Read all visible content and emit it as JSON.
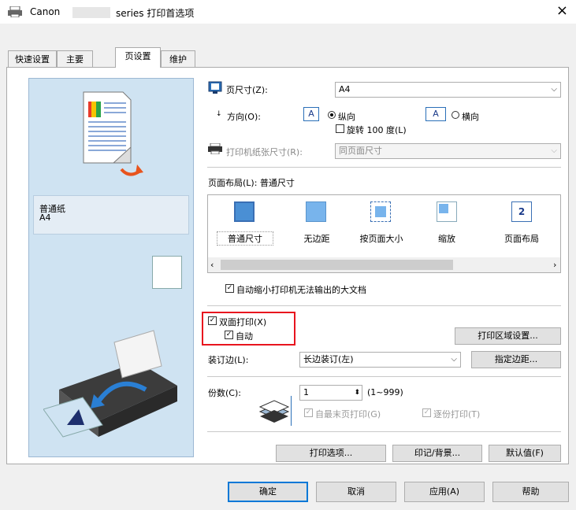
{
  "window": {
    "title": "Canon",
    "title_series": "series 打印首选项",
    "close": "×"
  },
  "tabs": [
    "快速设置",
    "主要",
    "页设置",
    "维护"
  ],
  "preview": {
    "paper_type": "普通纸",
    "paper_size": "A4"
  },
  "page_size": {
    "label": "页尺寸(Z):",
    "value": "A4"
  },
  "orientation": {
    "label": "方向(O):",
    "portrait": "纵向",
    "landscape": "横向",
    "rotate": "旋转 100 度(L)"
  },
  "printer_paper": {
    "label": "打印机纸张尺寸(R):",
    "value": "同页面尺寸"
  },
  "page_layout": {
    "label": "页面布局(L): 普通尺寸",
    "items": [
      "普通尺寸",
      "无边距",
      "按页面大小",
      "缩放",
      "页面布局"
    ],
    "page_number": "2"
  },
  "auto_reduce": "自动缩小打印机无法输出的大文档",
  "duplex": {
    "label": "双面打印(X)",
    "auto": "自动",
    "area_button": "打印区域设置..."
  },
  "binding": {
    "label": "装订边(L):",
    "value": "长边装订(左)",
    "margin_button": "指定边距..."
  },
  "copies": {
    "label": "份数(C):",
    "value": "1",
    "range": "(1~999)",
    "last_page": "自最末页打印(G)",
    "collate": "逐份打印(T)"
  },
  "bottom_buttons": {
    "options": "打印选项...",
    "stamp": "印记/背景...",
    "defaults": "默认值(F)"
  },
  "dialog_buttons": {
    "ok": "确定",
    "cancel": "取消",
    "apply": "应用(A)",
    "help": "帮助"
  },
  "colors": {
    "accent": "#e8141e",
    "preview_bg": "#cfe3f2"
  }
}
